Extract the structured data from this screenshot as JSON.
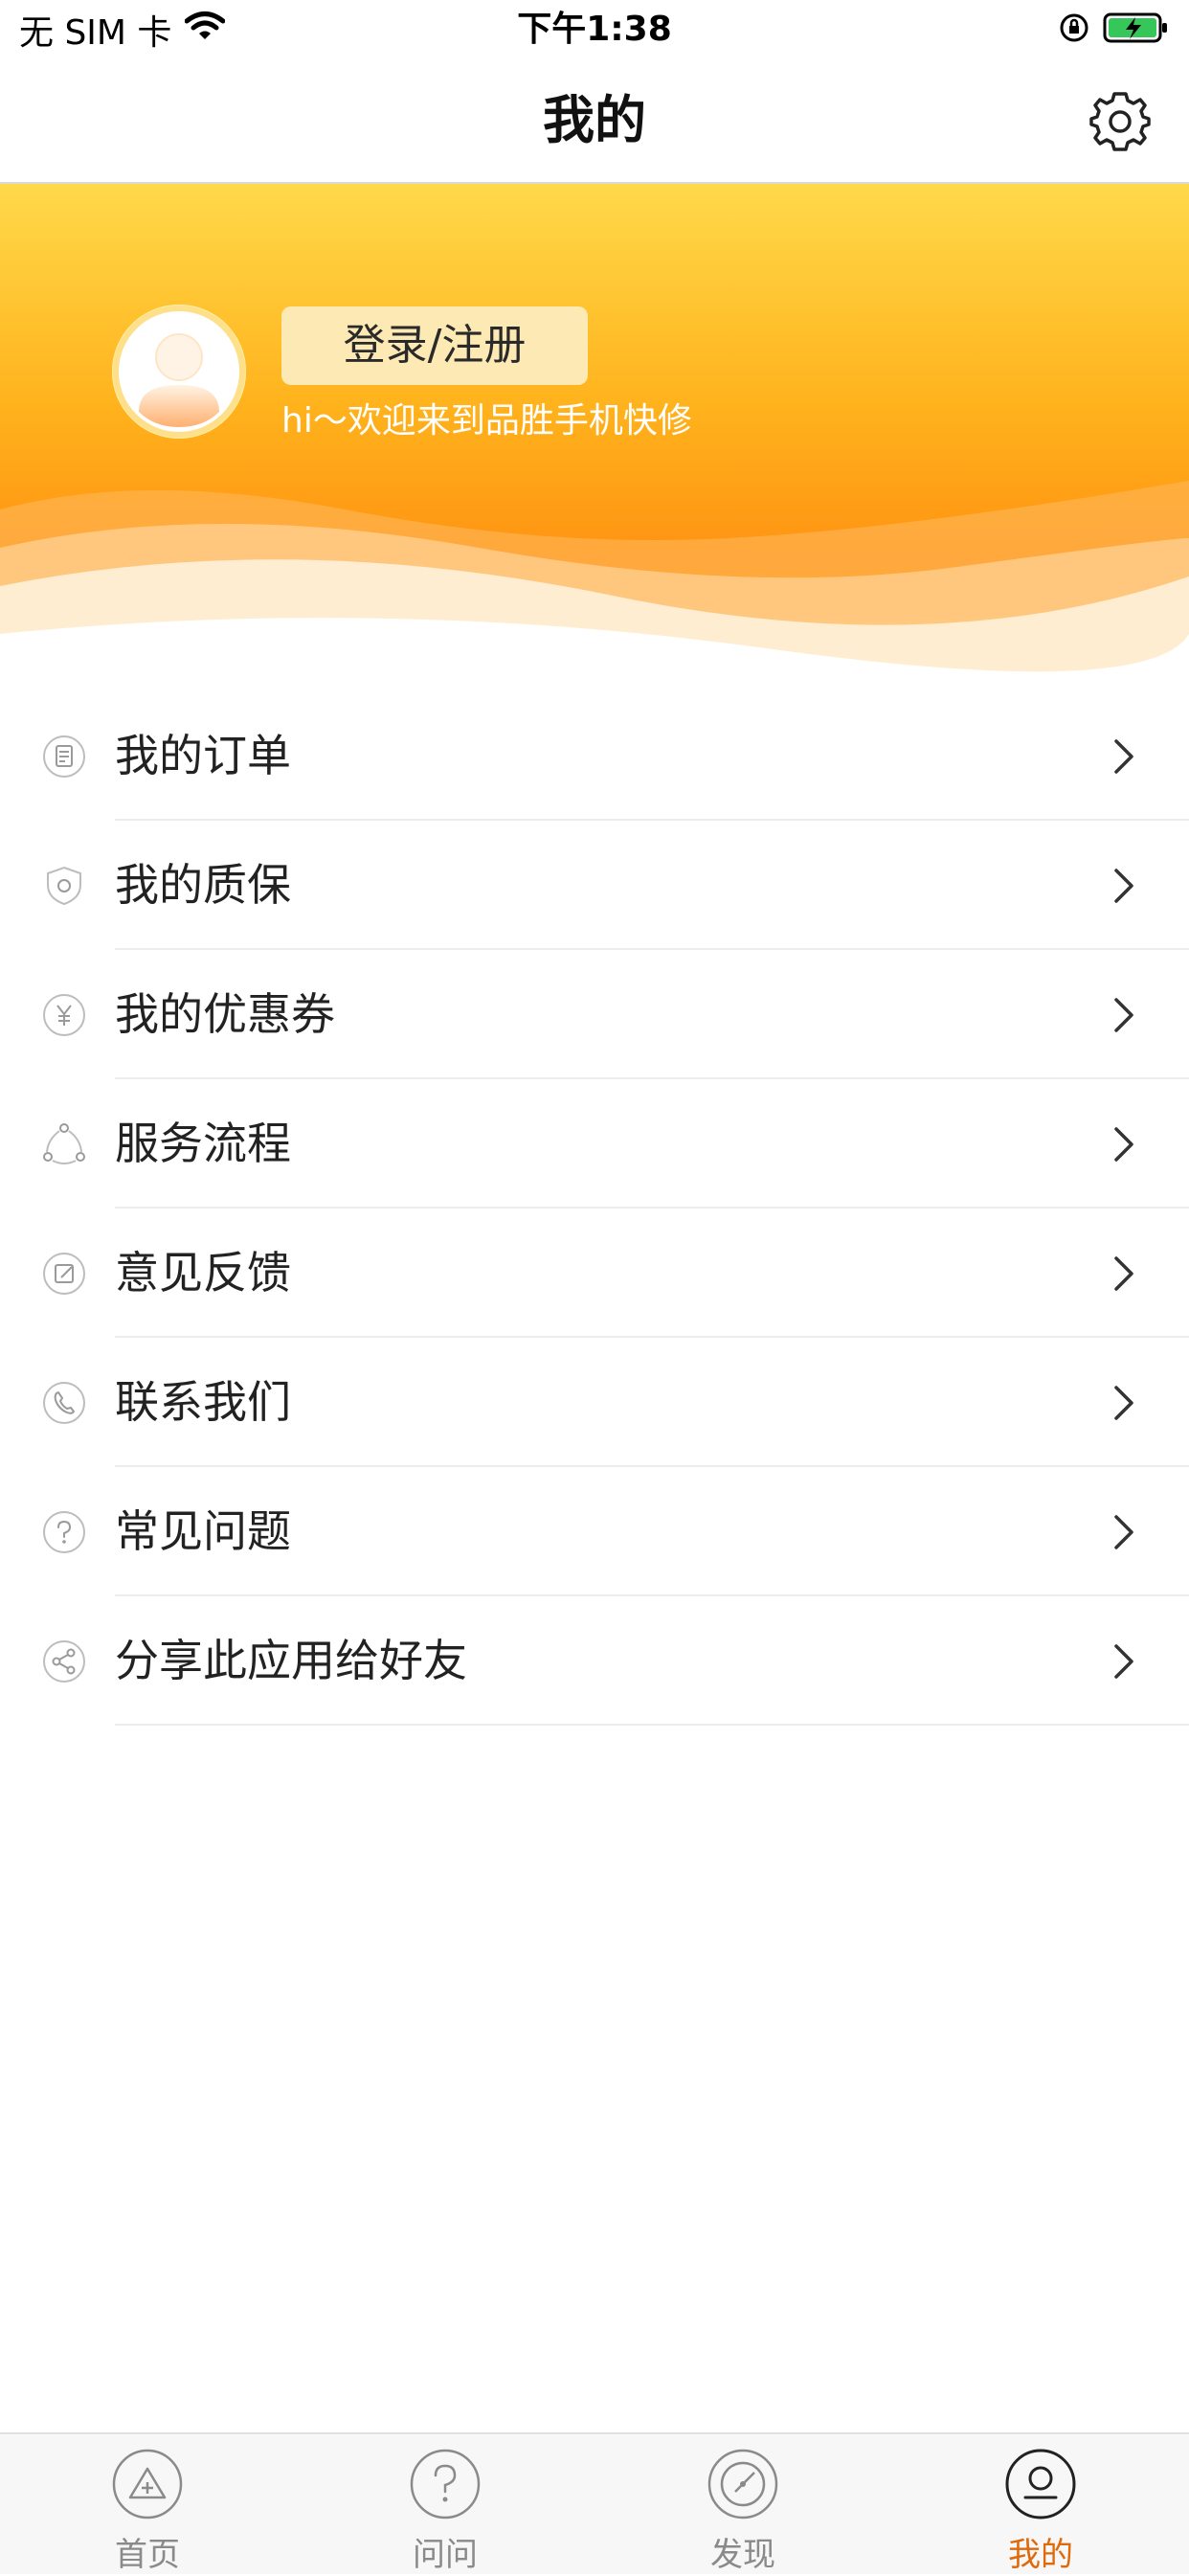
{
  "status_bar": {
    "carrier": "无 SIM 卡",
    "time": "下午1:38"
  },
  "nav": {
    "title": "我的"
  },
  "profile": {
    "login_label": "登录/注册",
    "welcome": "hi～欢迎来到品胜手机快修"
  },
  "menu": [
    {
      "label": "我的订单",
      "icon": "order-icon"
    },
    {
      "label": "我的质保",
      "icon": "shield-icon"
    },
    {
      "label": "我的优惠券",
      "icon": "coupon-icon"
    },
    {
      "label": "服务流程",
      "icon": "process-icon"
    },
    {
      "label": "意见反馈",
      "icon": "feedback-icon"
    },
    {
      "label": "联系我们",
      "icon": "phone-icon"
    },
    {
      "label": "常见问题",
      "icon": "question-icon"
    },
    {
      "label": "分享此应用给好友",
      "icon": "share-icon"
    }
  ],
  "tabs": [
    {
      "label": "首页",
      "icon": "home-icon",
      "active": false
    },
    {
      "label": "问问",
      "icon": "question-icon",
      "active": false
    },
    {
      "label": "发现",
      "icon": "compass-icon",
      "active": false
    },
    {
      "label": "我的",
      "icon": "profile-icon",
      "active": true
    }
  ],
  "colors": {
    "accent": "#e06a0a",
    "banner_top": "#ffd94a",
    "banner_bottom": "#ff9312"
  }
}
